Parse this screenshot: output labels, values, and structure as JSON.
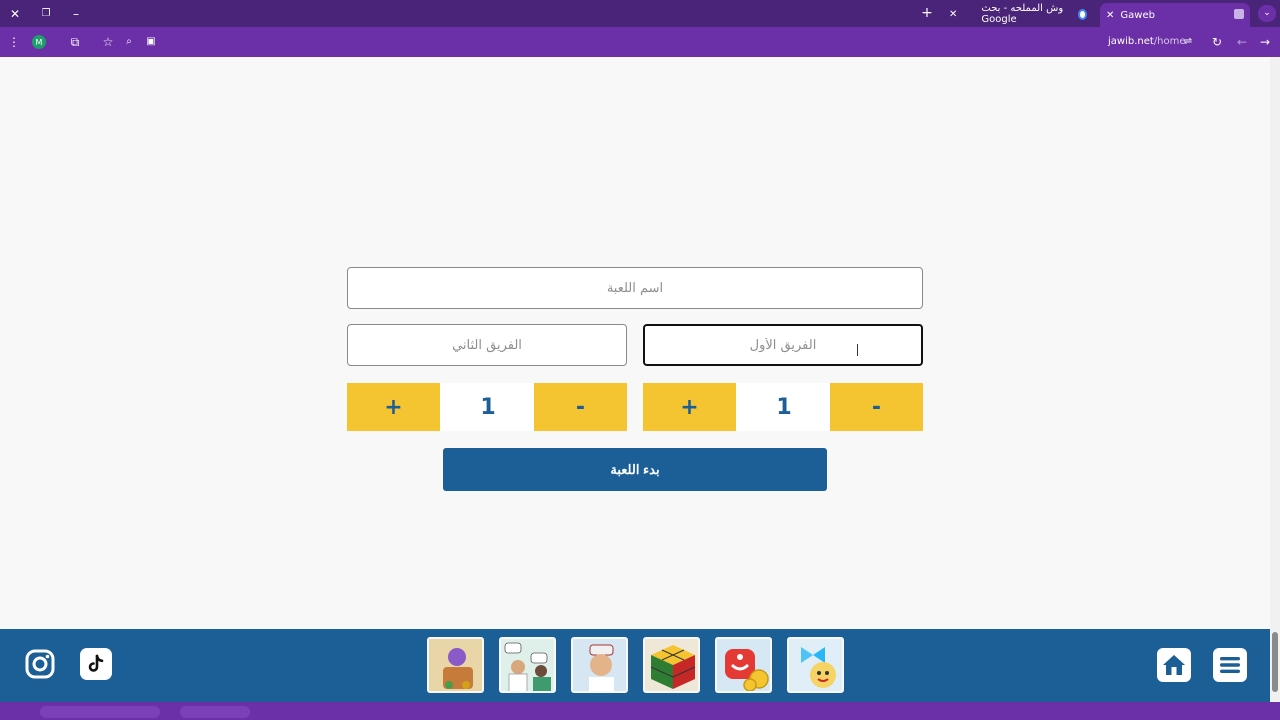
{
  "browser": {
    "tabs": [
      {
        "title": "Gaweb",
        "active": true
      },
      {
        "title": "وش المملحه - بحث Google",
        "active": false
      }
    ],
    "new_tab_label": "+",
    "profile_initial": "M",
    "url_host": "jawib.net",
    "url_path": "/home"
  },
  "form": {
    "game_name_placeholder": "اسم اللعبة",
    "team_two_placeholder": "الفريق الثاني",
    "team_one_placeholder": "الفريق الأول",
    "team_two": {
      "plus": "+",
      "value": "1",
      "minus": "-"
    },
    "team_one": {
      "plus": "+",
      "value": "1",
      "minus": "-"
    },
    "start_label": "بدء اللعبة"
  },
  "colors": {
    "accent_blue": "#1c5f96",
    "yellow": "#f5c531",
    "purple": "#6b2fa8"
  },
  "footer": {
    "social_icons": [
      "instagram-icon",
      "tiktok-icon"
    ],
    "games": [
      "game-thumb-1",
      "game-thumb-2",
      "game-thumb-3",
      "game-thumb-4",
      "game-thumb-5",
      "game-thumb-6"
    ],
    "nav_icons": [
      "home-icon",
      "menu-icon"
    ]
  }
}
